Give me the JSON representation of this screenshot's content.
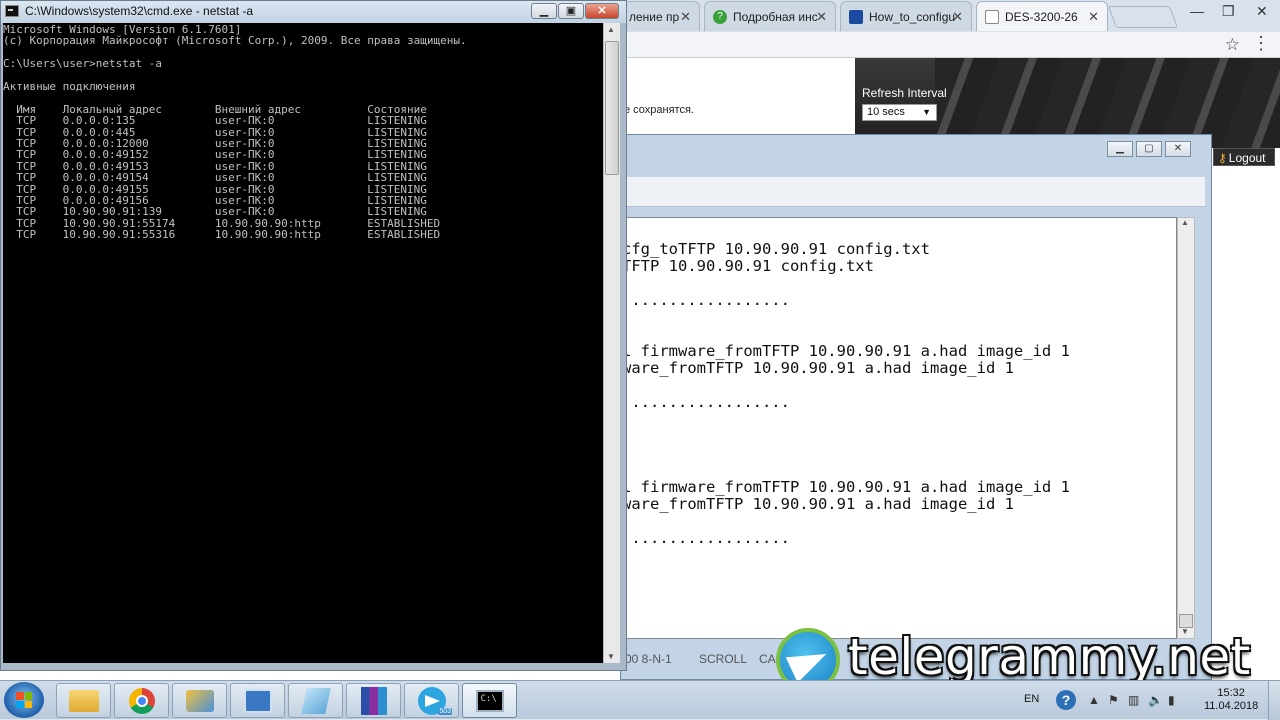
{
  "browser": {
    "tabs": [
      {
        "label": "ление пр",
        "icon": "tab-page-icon",
        "color": "#f0f0f0"
      },
      {
        "label": "Подробная инс",
        "icon": "green-question-icon",
        "color": "#3aa13a"
      },
      {
        "label": "How_to_configu",
        "icon": "dlink-icon",
        "color": "#1b4aa0"
      },
      {
        "label": "DES-3200-26",
        "icon": "page-icon",
        "color": "#ffffff"
      }
    ],
    "header_note": "е сохранятся.",
    "refresh_label": "Refresh Interval",
    "refresh_value": "10 secs",
    "logout_label": "Logout"
  },
  "telnet": {
    "lines": [
      "cfg_toTFTP 10.90.90.91 config.txt",
      "TFTP 10.90.90.91 config.txt",
      "",
      " .................",
      "",
      "",
      "l firmware_fromTFTP 10.90.90.91 a.had image_id 1",
      "ware_fromTFTP 10.90.90.91 a.had image_id 1",
      "",
      " .................",
      "",
      "",
      "",
      "",
      "l firmware_fromTFTP 10.90.90.91 a.had image_id 1",
      "ware_fromTFTP 10.90.90.91 a.had image_id 1",
      "",
      " ................."
    ],
    "status": {
      "port": "00 8-N-1",
      "scroll": "SCROLL",
      "caps": "CA"
    }
  },
  "cmd": {
    "title": "C:\\Windows\\system32\\cmd.exe - netstat  -a",
    "lines": [
      "Microsoft Windows [Version 6.1.7601]",
      "(c) Корпорация Майкрософт (Microsoft Corp.), 2009. Все права защищены.",
      "",
      "C:\\Users\\user>netstat -a",
      "",
      "Активные подключения",
      "",
      "  Имя    Локальный адрес        Внешний адрес          Состояние",
      "  TCP    0.0.0.0:135            user-ПК:0              LISTENING",
      "  TCP    0.0.0.0:445            user-ПК:0              LISTENING",
      "  TCP    0.0.0.0:12000          user-ПК:0              LISTENING",
      "  TCP    0.0.0.0:49152          user-ПК:0              LISTENING",
      "  TCP    0.0.0.0:49153          user-ПК:0              LISTENING",
      "  TCP    0.0.0.0:49154          user-ПК:0              LISTENING",
      "  TCP    0.0.0.0:49155          user-ПК:0              LISTENING",
      "  TCP    0.0.0.0:49156          user-ПК:0              LISTENING",
      "  TCP    10.90.90.91:139        user-ПК:0              LISTENING",
      "  TCP    10.90.90.91:55174      10.90.90.90:http       ESTABLISHED",
      "  TCP    10.90.90.91:55316      10.90.90.90:http       ESTABLISHED"
    ]
  },
  "watermark": {
    "text": "telegrammy.net"
  },
  "taskbar": {
    "apps": [
      {
        "name": "explorer",
        "icon": "folder-icon"
      },
      {
        "name": "chrome",
        "icon": "chrome-icon"
      },
      {
        "name": "network",
        "icon": "network-tool-icon"
      },
      {
        "name": "putty",
        "icon": "network-config-icon"
      },
      {
        "name": "notepad",
        "icon": "notepad-icon"
      },
      {
        "name": "winrar",
        "icon": "archive-icon"
      },
      {
        "name": "telegram",
        "icon": "telegram-icon",
        "badge": "503"
      },
      {
        "name": "cmd",
        "icon": "cmd-icon"
      }
    ],
    "lang": "EN",
    "time": "15:32",
    "date": "11.04.2018"
  }
}
